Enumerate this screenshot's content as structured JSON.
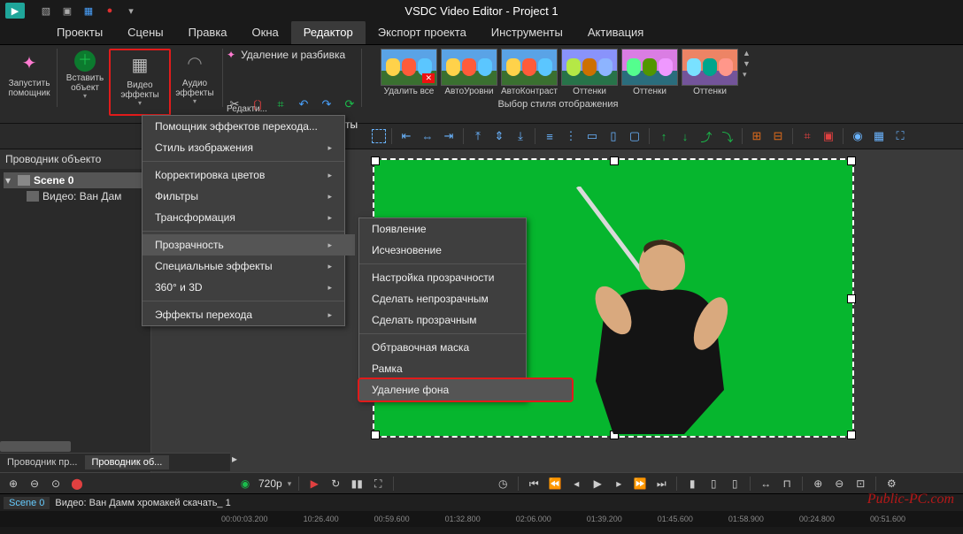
{
  "title": "VSDC Video Editor - Project 1",
  "menu": {
    "items": [
      "Проекты",
      "Сцены",
      "Правка",
      "Окна",
      "Редактор",
      "Экспорт проекта",
      "Инструменты",
      "Активация"
    ],
    "active": 4
  },
  "ribbon": {
    "run_wizard": "Запустить\nпомощник",
    "insert_obj": "Вставить\nобъект",
    "video_fx": "Видео\nэффекты",
    "audio_fx": "Аудио\nэффекты",
    "del_break": "Удаление и разбивка",
    "editing_lbl": "Редакти...",
    "thumbs": [
      {
        "label": "Удалить все",
        "x": true
      },
      {
        "label": "АвтоУровни"
      },
      {
        "label": "АвтоКонтраст"
      },
      {
        "label": "Оттенки"
      },
      {
        "label": "Оттенки"
      },
      {
        "label": "Оттенки"
      }
    ],
    "style_sel": "Выбор стиля отображения"
  },
  "ctx1": {
    "items": [
      "Помощник эффектов перехода...",
      "Стиль изображения",
      "Корректировка цветов",
      "Фильтры",
      "Трансформация",
      "Прозрачность",
      "Специальные эффекты",
      "360° и 3D",
      "Эффекты перехода"
    ],
    "sub_after": [
      0,
      4,
      7
    ],
    "hover": 5,
    "suffix": "ты"
  },
  "ctx2": {
    "items": [
      "Появление",
      "Исчезновение",
      "Настройка прозрачности",
      "Сделать непрозрачным",
      "Сделать прозрачным",
      "Обтравочная маска",
      "Рамка",
      "Удаление фона"
    ],
    "sep_after": [
      1,
      4
    ],
    "highlight": 7
  },
  "explorer": {
    "title": "Проводник объекто",
    "scene": "Scene 0",
    "video": "Видео: Ван Дам"
  },
  "tabs": {
    "a": "Проводник пр...",
    "b": "Проводник об..."
  },
  "playback": {
    "res": "720p"
  },
  "timeline": {
    "scene": "Scene 0",
    "clip": "Видео: Ван Дамм хромакей скачать_ 1",
    "marks": [
      "00:00:03.200",
      "10:26.400",
      "00:59.600",
      "01:32.800",
      "02:06.000",
      "01:39.200",
      "01:45.600",
      "01:58.900",
      "00:24.800",
      "00:51.600"
    ]
  },
  "watermark": "Public-PC.com"
}
